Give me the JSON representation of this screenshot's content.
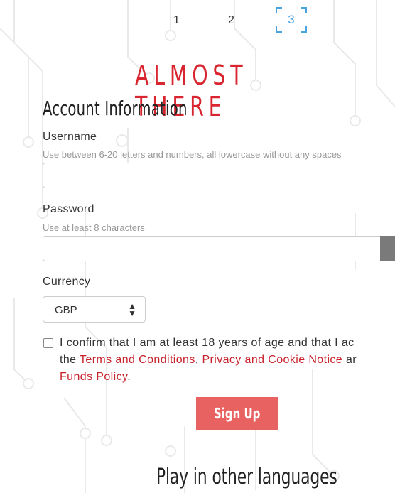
{
  "steps": {
    "step1": "1",
    "step2": "2",
    "step3": "3"
  },
  "headline": "ALMOST THERE",
  "section_title": "Account Information",
  "username": {
    "label": "Username",
    "hint": "Use between 6-20 letters and numbers, all lowercase without any spaces",
    "value": ""
  },
  "password": {
    "label": "Password",
    "hint": "Use at least 8 characters",
    "value": ""
  },
  "currency": {
    "label": "Currency",
    "selected": "GBP"
  },
  "confirm": {
    "text_prefix": "I confirm that I am at least 18 years of age and that I ac",
    "text_the": "the ",
    "terms_link": "Terms and Conditions",
    "comma": ", ",
    "privacy_link": "Privacy and Cookie Notice",
    "text_and": " ar",
    "funds_link": "Funds Policy",
    "period": "."
  },
  "signup_label": "Sign Up",
  "other_languages": "Play in other languages",
  "colors": {
    "accent_red": "#d9252f",
    "button_bg": "#e86262",
    "step_active": "#4aa3df",
    "link": "#c8232c"
  }
}
